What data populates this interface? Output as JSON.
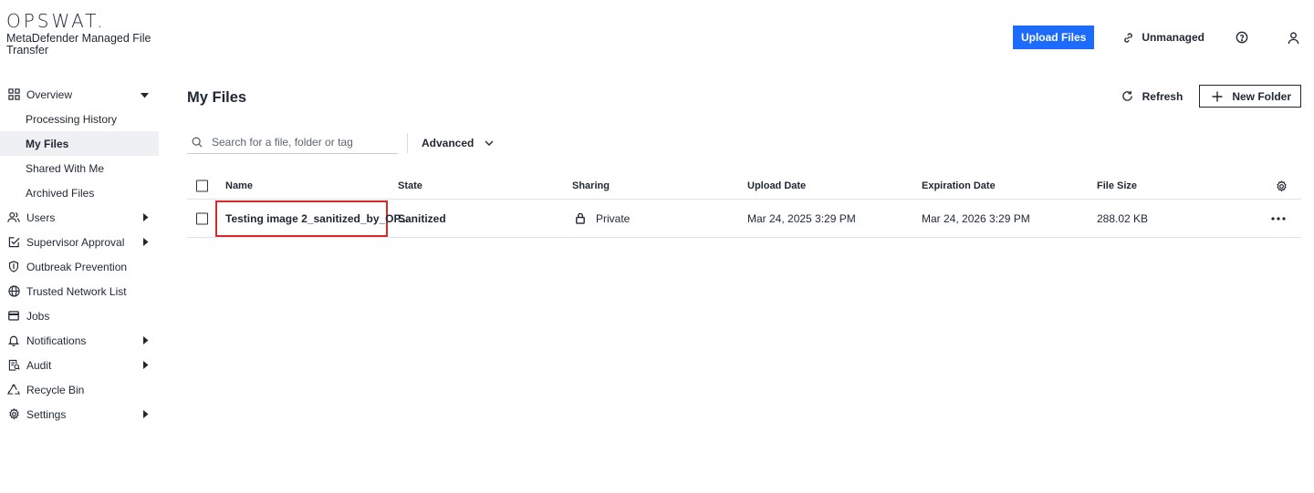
{
  "brand": {
    "logo": "OPSWAT.",
    "product": "MetaDefender Managed File Transfer"
  },
  "topbar": {
    "upload_label": "Upload Files",
    "unmanaged_label": "Unmanaged"
  },
  "sidebar": {
    "items": [
      {
        "label": "Overview",
        "icon": "grid-icon",
        "expandable": true,
        "expanded": true
      },
      {
        "label": "Processing History",
        "sub": true
      },
      {
        "label": "My Files",
        "sub": true,
        "active": true
      },
      {
        "label": "Shared With Me",
        "sub": true
      },
      {
        "label": "Archived Files",
        "sub": true
      },
      {
        "label": "Users",
        "icon": "users-icon",
        "expandable": true
      },
      {
        "label": "Supervisor Approval",
        "icon": "approval-icon",
        "expandable": true
      },
      {
        "label": "Outbreak Prevention",
        "icon": "shield-icon"
      },
      {
        "label": "Trusted Network List",
        "icon": "globe-icon"
      },
      {
        "label": "Jobs",
        "icon": "jobs-icon"
      },
      {
        "label": "Notifications",
        "icon": "bell-icon",
        "expandable": true
      },
      {
        "label": "Audit",
        "icon": "audit-icon",
        "expandable": true
      },
      {
        "label": "Recycle Bin",
        "icon": "recycle-icon"
      },
      {
        "label": "Settings",
        "icon": "gear-icon",
        "expandable": true
      }
    ]
  },
  "main": {
    "title": "My Files",
    "refresh_label": "Refresh",
    "new_folder_label": "New Folder",
    "search_placeholder": "Search for a file, folder or tag",
    "advanced_label": "Advanced"
  },
  "table": {
    "columns": [
      "Name",
      "State",
      "Sharing",
      "Upload Date",
      "Expiration Date",
      "File Size"
    ],
    "rows": [
      {
        "name": "Testing image 2_sanitized_by_OP...",
        "state": "Sanitized",
        "sharing": "Private",
        "upload_date": "Mar 24, 2025 3:29 PM",
        "expiration_date": "Mar 24, 2026 3:29 PM",
        "file_size": "288.02 KB"
      }
    ]
  },
  "colors": {
    "accent": "#1d6bfc",
    "highlight": "#d42a2a",
    "active_nav_bg": "#eef0f3"
  }
}
